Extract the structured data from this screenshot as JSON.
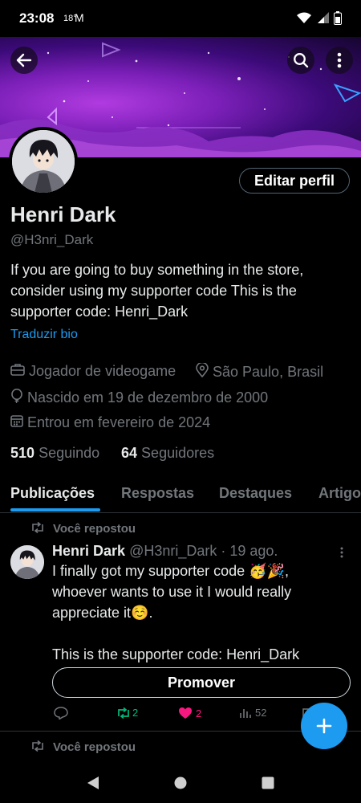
{
  "status": {
    "time": "23:08",
    "temp": "18°"
  },
  "profile": {
    "name": "Henri Dark",
    "handle": "@H3nri_Dark",
    "edit_label": "Editar perfil",
    "bio_lines": [
      "If you are going to buy something in the store,",
      "consider using my supporter code  This is the",
      "supporter code: Henri_Dark"
    ],
    "translate_label": "Traduzir bio",
    "occupation": "Jogador de videogame",
    "location": "São Paulo, Brasil",
    "birthday": "Nascido em 19 de dezembro de 2000",
    "joined": "Entrou em fevereiro de 2024",
    "following_count": "510",
    "following_label": "Seguindo",
    "followers_count": "64",
    "followers_label": "Seguidores"
  },
  "tabs": [
    "Publicações",
    "Respostas",
    "Destaques",
    "Artigos"
  ],
  "feed": {
    "repost_label": "Você repostou",
    "post": {
      "author": "Henri Dark",
      "meta": "@H3nri_Dark · 19 ago.",
      "text_lines": [
        "I finally got my supporter code 🥳🎉,",
        "whoever wants to use it I would really",
        "appreciate it☺️.",
        "",
        "This is the supporter code: Henri_Dark"
      ],
      "promote_label": "Promover",
      "reposts": "2",
      "likes": "2",
      "views": "52"
    },
    "next_repost_label": "Você repostou"
  },
  "colors": {
    "accent": "#1d9bf0",
    "repost": "#00ba7c",
    "like": "#f91880"
  }
}
